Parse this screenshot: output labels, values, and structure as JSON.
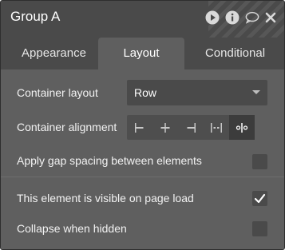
{
  "header": {
    "title": "Group A",
    "icons": [
      "play-icon",
      "info-icon",
      "comment-icon",
      "close-icon"
    ]
  },
  "tabs": [
    {
      "label": "Appearance",
      "active": false
    },
    {
      "label": "Layout",
      "active": true
    },
    {
      "label": "Conditional",
      "active": false
    }
  ],
  "layout": {
    "container_layout_label": "Container layout",
    "container_layout_value": "Row",
    "container_alignment_label": "Container alignment",
    "alignment_options": [
      "align-left-icon",
      "align-center-icon",
      "align-right-icon",
      "space-between-icon",
      "space-around-icon"
    ],
    "alignment_selected": "space-around-icon",
    "gap_label": "Apply gap spacing between elements",
    "gap_checked": false,
    "visible_label": "This element is visible on page load",
    "visible_checked": true,
    "collapse_label": "Collapse when hidden",
    "collapse_checked": false
  },
  "colors": {
    "panel_bg": "#4a4a4a",
    "body_bg": "#5f5f5f",
    "text": "#f2f2f2"
  }
}
